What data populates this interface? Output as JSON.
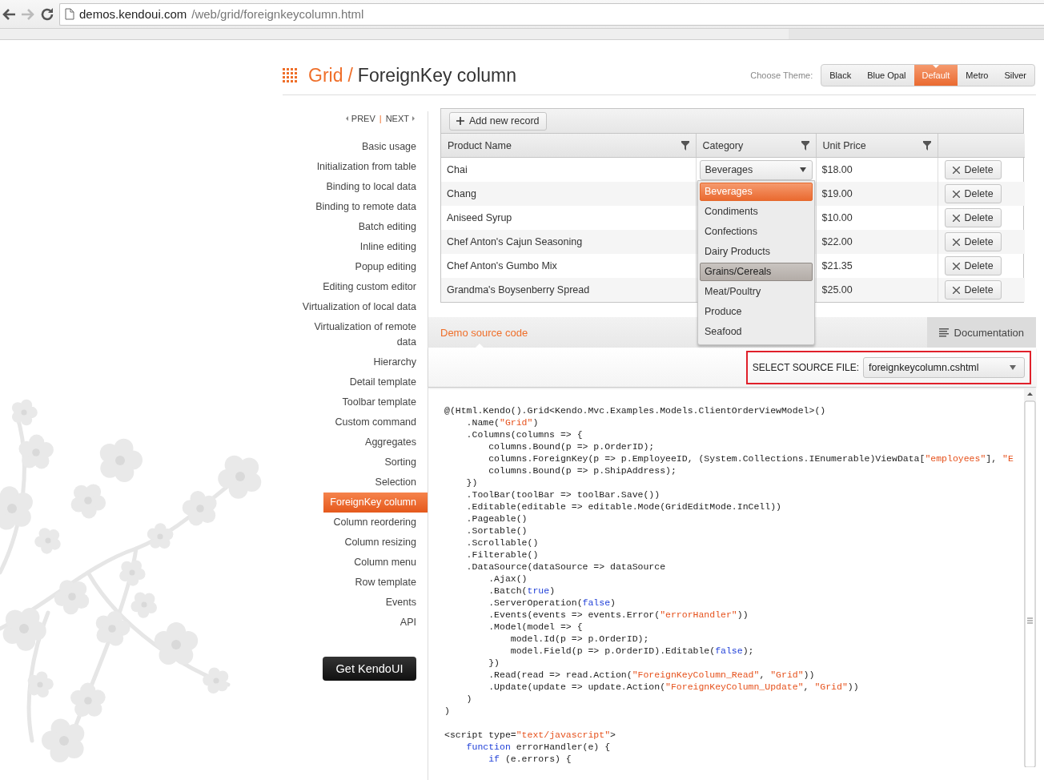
{
  "browser": {
    "url_host": "demos.kendoui.com",
    "url_path": "/web/grid/foreignkeycolumn.html"
  },
  "header": {
    "section": "Grid",
    "separator": "/",
    "title": "ForeignKey column",
    "theme_label": "Choose Theme:",
    "themes": [
      {
        "label": "Black",
        "selected": false
      },
      {
        "label": "Blue Opal",
        "selected": false
      },
      {
        "label": "Default",
        "selected": true
      },
      {
        "label": "Metro",
        "selected": false
      },
      {
        "label": "Silver",
        "selected": false
      }
    ]
  },
  "nav": {
    "prev": "PREV",
    "separator": "|",
    "next": "NEXT",
    "items": [
      {
        "label": "Basic usage",
        "selected": false
      },
      {
        "label": "Initialization from table",
        "selected": false
      },
      {
        "label": "Binding to local data",
        "selected": false
      },
      {
        "label": "Binding to remote data",
        "selected": false
      },
      {
        "label": "Batch editing",
        "selected": false
      },
      {
        "label": "Inline editing",
        "selected": false
      },
      {
        "label": "Popup editing",
        "selected": false
      },
      {
        "label": "Editing custom editor",
        "selected": false
      },
      {
        "label": "Virtualization of local data",
        "selected": false
      },
      {
        "label": "Virtualization of remote data",
        "selected": false
      },
      {
        "label": "Hierarchy",
        "selected": false
      },
      {
        "label": "Detail template",
        "selected": false
      },
      {
        "label": "Toolbar template",
        "selected": false
      },
      {
        "label": "Custom command",
        "selected": false
      },
      {
        "label": "Aggregates",
        "selected": false
      },
      {
        "label": "Sorting",
        "selected": false
      },
      {
        "label": "Selection",
        "selected": false
      },
      {
        "label": "ForeignKey column",
        "selected": true
      },
      {
        "label": "Column reordering",
        "selected": false
      },
      {
        "label": "Column resizing",
        "selected": false
      },
      {
        "label": "Column menu",
        "selected": false
      },
      {
        "label": "Row template",
        "selected": false
      },
      {
        "label": "Events",
        "selected": false
      },
      {
        "label": "API",
        "selected": false
      }
    ],
    "cta": "Get KendoUI"
  },
  "grid": {
    "toolbar_button": "Add new record",
    "columns": [
      "Product Name",
      "Category",
      "Unit Price"
    ],
    "rows": [
      {
        "product": "Chai",
        "price": "$18.00",
        "command": "Delete"
      },
      {
        "product": "Chang",
        "price": "$19.00",
        "command": "Delete"
      },
      {
        "product": "Aniseed Syrup",
        "price": "$10.00",
        "command": "Delete"
      },
      {
        "product": "Chef Anton's Cajun Seasoning",
        "price": "$22.00",
        "command": "Delete"
      },
      {
        "product": "Chef Anton's Gumbo Mix",
        "price": "$21.35",
        "command": "Delete"
      },
      {
        "product": "Grandma's Boysenberry Spread",
        "price": "$25.00",
        "command": "Delete"
      }
    ],
    "category_editor": {
      "value": "Beverages",
      "options": [
        {
          "label": "Beverages",
          "selected": true,
          "hovered": false
        },
        {
          "label": "Condiments",
          "selected": false,
          "hovered": false
        },
        {
          "label": "Confections",
          "selected": false,
          "hovered": false
        },
        {
          "label": "Dairy Products",
          "selected": false,
          "hovered": false
        },
        {
          "label": "Grains/Cereals",
          "selected": false,
          "hovered": true
        },
        {
          "label": "Meat/Poultry",
          "selected": false,
          "hovered": false
        },
        {
          "label": "Produce",
          "selected": false,
          "hovered": false
        },
        {
          "label": "Seafood",
          "selected": false,
          "hovered": false
        }
      ]
    }
  },
  "source": {
    "tabs": [
      {
        "label": "Demo source code",
        "selected": true
      },
      {
        "label": "Documentation",
        "selected": false
      }
    ],
    "file_label": "SELECT SOURCE FILE:",
    "file_value": "foreignkeycolumn.cshtml",
    "file_highlighted": true,
    "lines": [
      {
        "segments": [
          {
            "kind": "text",
            "text": "@(Html.Kendo().Grid<Kendo.Mvc.Examples.Models.ClientOrderViewModel>()"
          }
        ]
      },
      {
        "segments": [
          {
            "kind": "text",
            "text": "    .Name("
          },
          {
            "kind": "string",
            "text": "\"Grid\""
          },
          {
            "kind": "text",
            "text": ")"
          }
        ]
      },
      {
        "segments": [
          {
            "kind": "text",
            "text": "    .Columns(columns => {"
          }
        ]
      },
      {
        "segments": [
          {
            "kind": "text",
            "text": "        columns.Bound(p => p.OrderID);"
          }
        ]
      },
      {
        "segments": [
          {
            "kind": "text",
            "text": "        columns.ForeignKey(p => p.EmployeeID, (System.Collections.IEnumerable)ViewData["
          },
          {
            "kind": "string",
            "text": "\"employees\""
          },
          {
            "kind": "text",
            "text": "], "
          },
          {
            "kind": "string",
            "text": "\"E"
          }
        ]
      },
      {
        "segments": [
          {
            "kind": "text",
            "text": "        columns.Bound(p => p.ShipAddress);"
          }
        ]
      },
      {
        "segments": [
          {
            "kind": "text",
            "text": "    })"
          }
        ]
      },
      {
        "segments": [
          {
            "kind": "text",
            "text": "    .ToolBar(toolBar => toolBar.Save())"
          }
        ]
      },
      {
        "segments": [
          {
            "kind": "text",
            "text": "    .Editable(editable => editable.Mode(GridEditMode.InCell))"
          }
        ]
      },
      {
        "segments": [
          {
            "kind": "text",
            "text": "    .Pageable()"
          }
        ]
      },
      {
        "segments": [
          {
            "kind": "text",
            "text": "    .Sortable()"
          }
        ]
      },
      {
        "segments": [
          {
            "kind": "text",
            "text": "    .Scrollable()"
          }
        ]
      },
      {
        "segments": [
          {
            "kind": "text",
            "text": "    .Filterable()"
          }
        ]
      },
      {
        "segments": [
          {
            "kind": "text",
            "text": "    .DataSource(dataSource => dataSource"
          }
        ]
      },
      {
        "segments": [
          {
            "kind": "text",
            "text": "        .Ajax()"
          }
        ]
      },
      {
        "segments": [
          {
            "kind": "text",
            "text": "        .Batch("
          },
          {
            "kind": "keyword",
            "text": "true"
          },
          {
            "kind": "text",
            "text": ")"
          }
        ]
      },
      {
        "segments": [
          {
            "kind": "text",
            "text": "        .ServerOperation("
          },
          {
            "kind": "keyword",
            "text": "false"
          },
          {
            "kind": "text",
            "text": ")"
          }
        ]
      },
      {
        "segments": [
          {
            "kind": "text",
            "text": "        .Events(events => events.Error("
          },
          {
            "kind": "string",
            "text": "\"errorHandler\""
          },
          {
            "kind": "text",
            "text": "))"
          }
        ]
      },
      {
        "segments": [
          {
            "kind": "text",
            "text": "        .Model(model => {"
          }
        ]
      },
      {
        "segments": [
          {
            "kind": "text",
            "text": "            model.Id(p => p.OrderID);"
          }
        ]
      },
      {
        "segments": [
          {
            "kind": "text",
            "text": "            model.Field(p => p.OrderID).Editable("
          },
          {
            "kind": "keyword",
            "text": "false"
          },
          {
            "kind": "text",
            "text": ");"
          }
        ]
      },
      {
        "segments": [
          {
            "kind": "text",
            "text": "        })"
          }
        ]
      },
      {
        "segments": [
          {
            "kind": "text",
            "text": "        .Read(read => read.Action("
          },
          {
            "kind": "string",
            "text": "\"ForeignKeyColumn_Read\""
          },
          {
            "kind": "text",
            "text": ", "
          },
          {
            "kind": "string",
            "text": "\"Grid\""
          },
          {
            "kind": "text",
            "text": "))"
          }
        ]
      },
      {
        "segments": [
          {
            "kind": "text",
            "text": "        .Update(update => update.Action("
          },
          {
            "kind": "string",
            "text": "\"ForeignKeyColumn_Update\""
          },
          {
            "kind": "text",
            "text": ", "
          },
          {
            "kind": "string",
            "text": "\"Grid\""
          },
          {
            "kind": "text",
            "text": "))"
          }
        ]
      },
      {
        "segments": [
          {
            "kind": "text",
            "text": "    )"
          }
        ]
      },
      {
        "segments": [
          {
            "kind": "text",
            "text": ")"
          }
        ]
      },
      {
        "spacer_before": true,
        "segments": [
          {
            "kind": "text",
            "text": "<script type="
          },
          {
            "kind": "string",
            "text": "\"text/javascript\""
          },
          {
            "kind": "text",
            "text": ">"
          }
        ]
      },
      {
        "segments": [
          {
            "kind": "keyword",
            "text": "    function"
          },
          {
            "kind": "text",
            "text": " errorHandler(e) {"
          }
        ]
      },
      {
        "segments": [
          {
            "kind": "keyword",
            "text": "        if"
          },
          {
            "kind": "text",
            "text": " (e.errors) {"
          }
        ]
      }
    ]
  }
}
